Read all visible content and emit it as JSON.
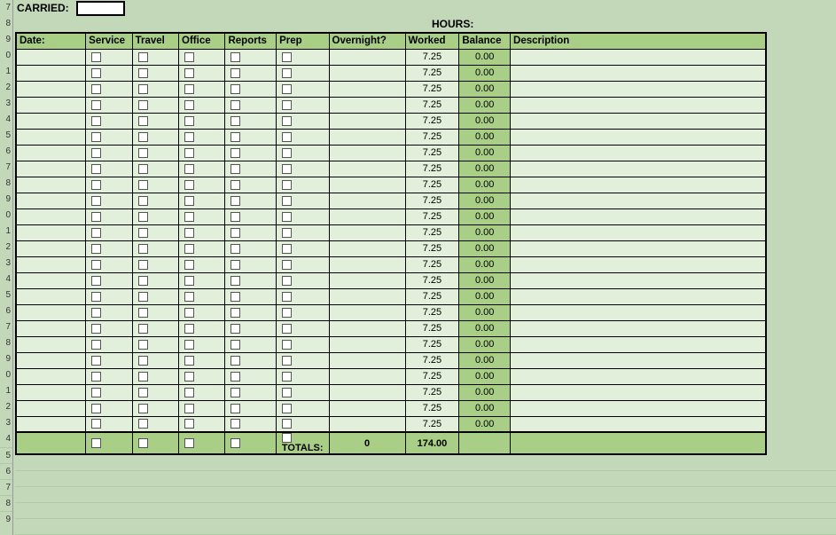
{
  "labels": {
    "carried": "CARRIED:",
    "hours": "HOURS:",
    "totals": "TOTALS:"
  },
  "columns": {
    "date": "Date:",
    "service": "Service",
    "travel": "Travel",
    "office": "Office",
    "reports": "Reports",
    "prep": "Prep",
    "overnight": "Overnight?",
    "worked": "Worked",
    "balance": "Balance",
    "description": "Description"
  },
  "carried_value": "",
  "rows": [
    {
      "date": "",
      "service": false,
      "travel": false,
      "office": false,
      "reports": false,
      "prep": false,
      "overnight": "",
      "worked": "7.25",
      "balance": "0.00",
      "description": ""
    },
    {
      "date": "",
      "service": false,
      "travel": false,
      "office": false,
      "reports": false,
      "prep": false,
      "overnight": "",
      "worked": "7.25",
      "balance": "0.00",
      "description": ""
    },
    {
      "date": "",
      "service": false,
      "travel": false,
      "office": false,
      "reports": false,
      "prep": false,
      "overnight": "",
      "worked": "7.25",
      "balance": "0.00",
      "description": ""
    },
    {
      "date": "",
      "service": false,
      "travel": false,
      "office": false,
      "reports": false,
      "prep": false,
      "overnight": "",
      "worked": "7.25",
      "balance": "0.00",
      "description": ""
    },
    {
      "date": "",
      "service": false,
      "travel": false,
      "office": false,
      "reports": false,
      "prep": false,
      "overnight": "",
      "worked": "7.25",
      "balance": "0.00",
      "description": ""
    },
    {
      "date": "",
      "service": false,
      "travel": false,
      "office": false,
      "reports": false,
      "prep": false,
      "overnight": "",
      "worked": "7.25",
      "balance": "0.00",
      "description": ""
    },
    {
      "date": "",
      "service": false,
      "travel": false,
      "office": false,
      "reports": false,
      "prep": false,
      "overnight": "",
      "worked": "7.25",
      "balance": "0.00",
      "description": ""
    },
    {
      "date": "",
      "service": false,
      "travel": false,
      "office": false,
      "reports": false,
      "prep": false,
      "overnight": "",
      "worked": "7.25",
      "balance": "0.00",
      "description": ""
    },
    {
      "date": "",
      "service": false,
      "travel": false,
      "office": false,
      "reports": false,
      "prep": false,
      "overnight": "",
      "worked": "7.25",
      "balance": "0.00",
      "description": ""
    },
    {
      "date": "",
      "service": false,
      "travel": false,
      "office": false,
      "reports": false,
      "prep": false,
      "overnight": "",
      "worked": "7.25",
      "balance": "0.00",
      "description": ""
    },
    {
      "date": "",
      "service": false,
      "travel": false,
      "office": false,
      "reports": false,
      "prep": false,
      "overnight": "",
      "worked": "7.25",
      "balance": "0.00",
      "description": ""
    },
    {
      "date": "",
      "service": false,
      "travel": false,
      "office": false,
      "reports": false,
      "prep": false,
      "overnight": "",
      "worked": "7.25",
      "balance": "0.00",
      "description": ""
    },
    {
      "date": "",
      "service": false,
      "travel": false,
      "office": false,
      "reports": false,
      "prep": false,
      "overnight": "",
      "worked": "7.25",
      "balance": "0.00",
      "description": ""
    },
    {
      "date": "",
      "service": false,
      "travel": false,
      "office": false,
      "reports": false,
      "prep": false,
      "overnight": "",
      "worked": "7.25",
      "balance": "0.00",
      "description": ""
    },
    {
      "date": "",
      "service": false,
      "travel": false,
      "office": false,
      "reports": false,
      "prep": false,
      "overnight": "",
      "worked": "7.25",
      "balance": "0.00",
      "description": ""
    },
    {
      "date": "",
      "service": false,
      "travel": false,
      "office": false,
      "reports": false,
      "prep": false,
      "overnight": "",
      "worked": "7.25",
      "balance": "0.00",
      "description": ""
    },
    {
      "date": "",
      "service": false,
      "travel": false,
      "office": false,
      "reports": false,
      "prep": false,
      "overnight": "",
      "worked": "7.25",
      "balance": "0.00",
      "description": ""
    },
    {
      "date": "",
      "service": false,
      "travel": false,
      "office": false,
      "reports": false,
      "prep": false,
      "overnight": "",
      "worked": "7.25",
      "balance": "0.00",
      "description": ""
    },
    {
      "date": "",
      "service": false,
      "travel": false,
      "office": false,
      "reports": false,
      "prep": false,
      "overnight": "",
      "worked": "7.25",
      "balance": "0.00",
      "description": ""
    },
    {
      "date": "",
      "service": false,
      "travel": false,
      "office": false,
      "reports": false,
      "prep": false,
      "overnight": "",
      "worked": "7.25",
      "balance": "0.00",
      "description": ""
    },
    {
      "date": "",
      "service": false,
      "travel": false,
      "office": false,
      "reports": false,
      "prep": false,
      "overnight": "",
      "worked": "7.25",
      "balance": "0.00",
      "description": ""
    },
    {
      "date": "",
      "service": false,
      "travel": false,
      "office": false,
      "reports": false,
      "prep": false,
      "overnight": "",
      "worked": "7.25",
      "balance": "0.00",
      "description": ""
    },
    {
      "date": "",
      "service": false,
      "travel": false,
      "office": false,
      "reports": false,
      "prep": false,
      "overnight": "",
      "worked": "7.25",
      "balance": "0.00",
      "description": ""
    },
    {
      "date": "",
      "service": false,
      "travel": false,
      "office": false,
      "reports": false,
      "prep": false,
      "overnight": "",
      "worked": "7.25",
      "balance": "0.00",
      "description": ""
    }
  ],
  "totals": {
    "overnight": "0",
    "worked": "174.00"
  },
  "row_headers_start": 7,
  "row_headers_count": 33
}
